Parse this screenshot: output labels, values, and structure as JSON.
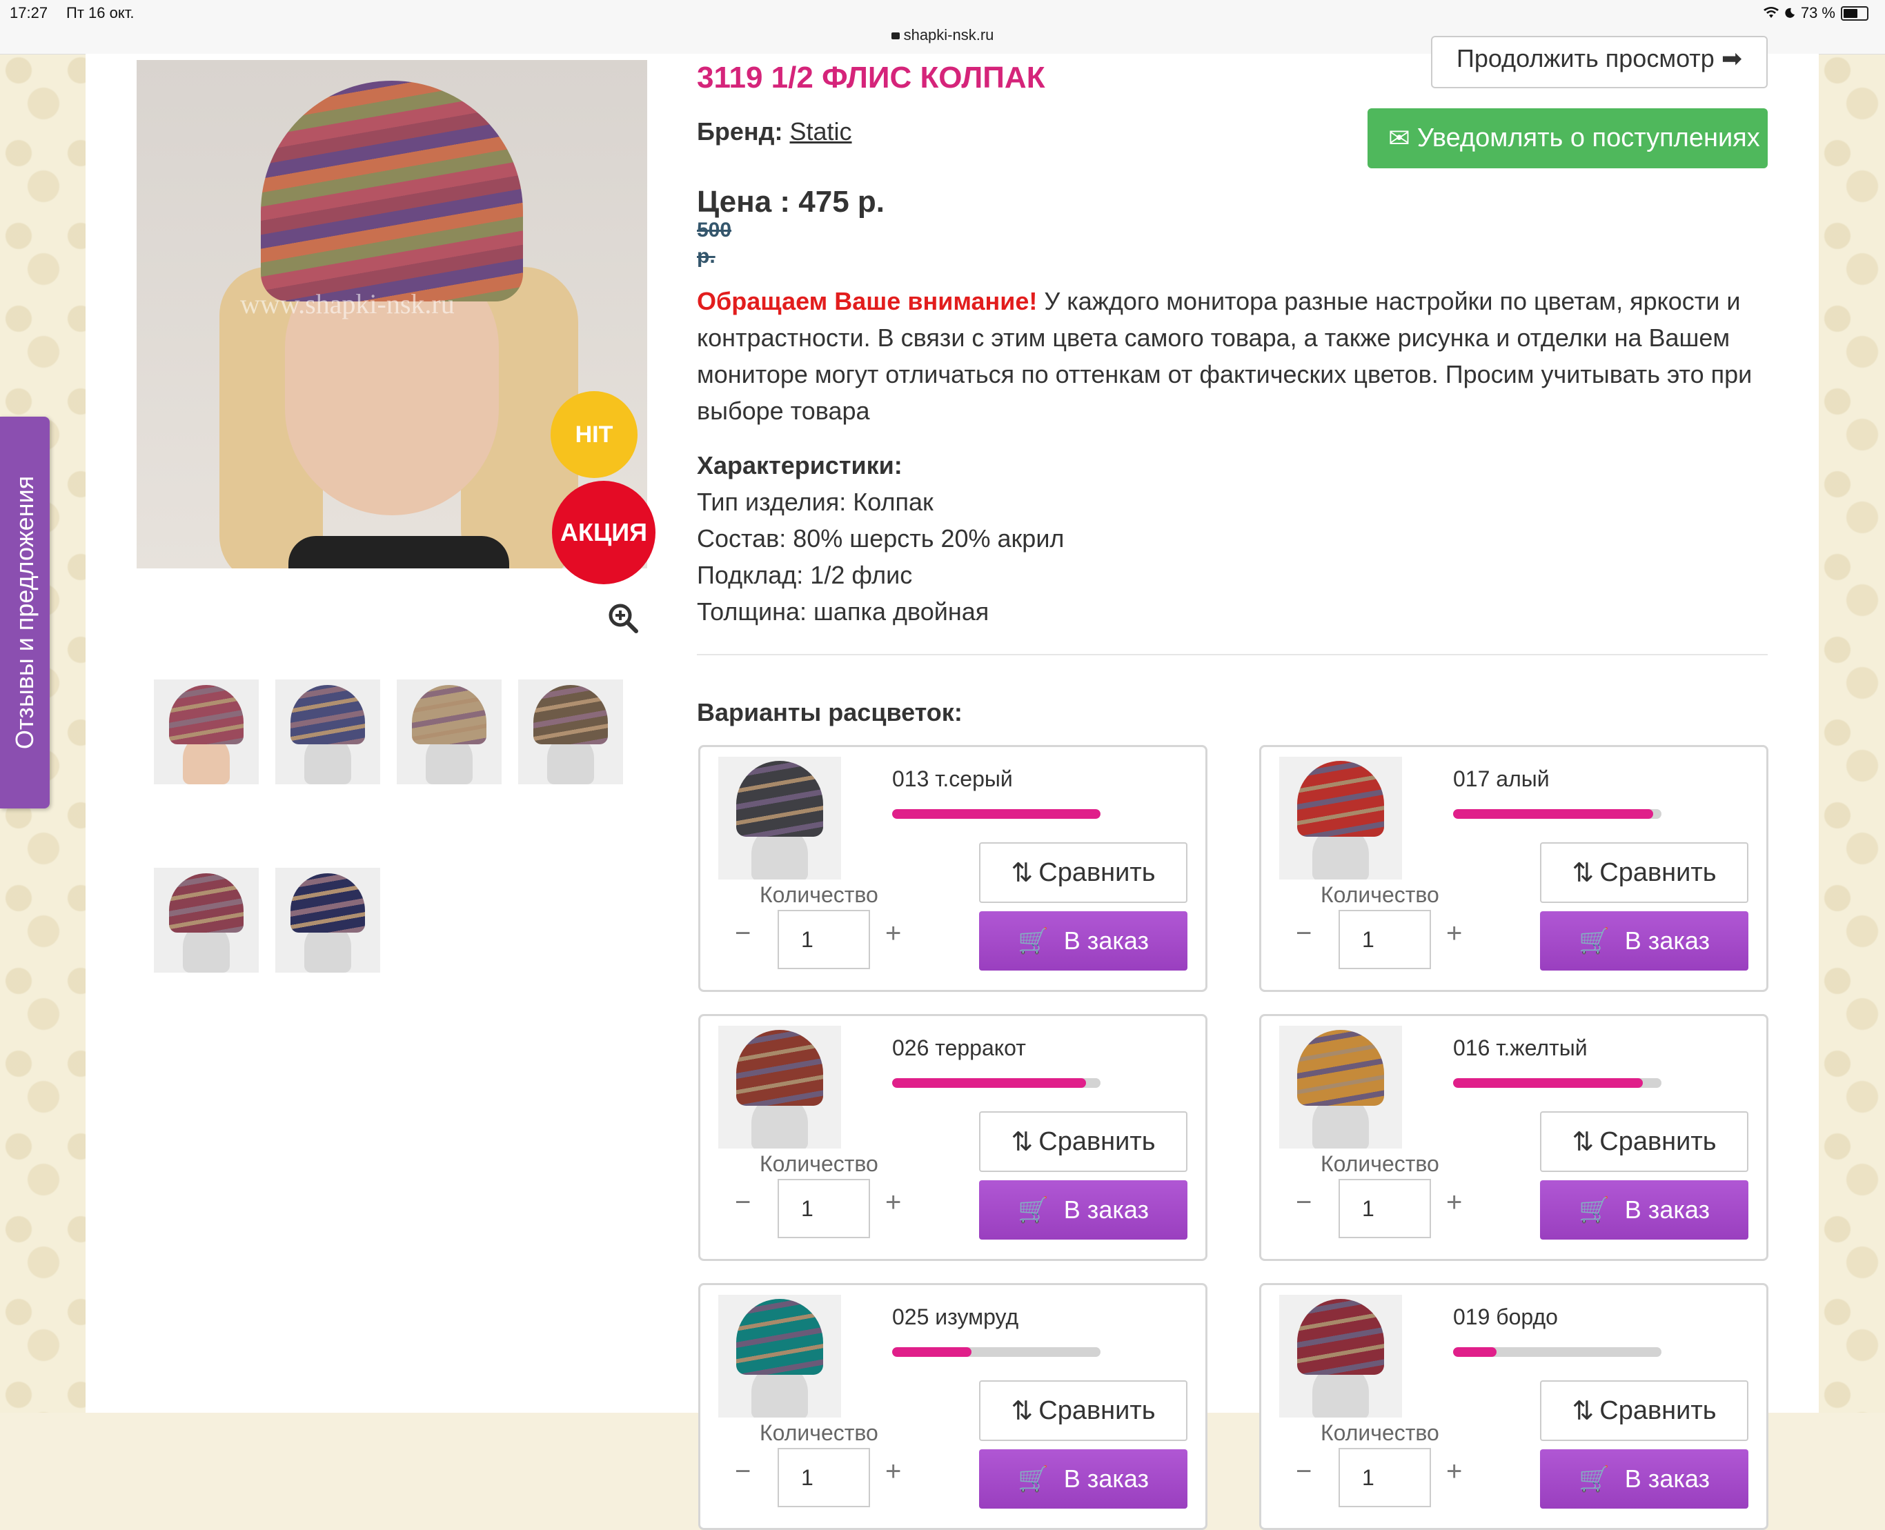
{
  "status_bar": {
    "time": "17:27",
    "date": "Пт 16 окт.",
    "battery": "73 %",
    "battery_level": 0.73
  },
  "browser": {
    "url": "shapki-nsk.ru"
  },
  "side_tab": {
    "label": "Отзывы и предложения"
  },
  "product": {
    "title": "3119 1/2 ФЛИС КОЛПАК",
    "brand_label": "Бренд:",
    "brand_value": "Static",
    "price": "Цена : 475 р.",
    "old_price": "500 р.",
    "watermark": "www.shapki-nsk.ru",
    "badges": {
      "hit": "HIT",
      "sale": "АКЦИЯ"
    }
  },
  "buttons": {
    "continue": "Продолжить просмотр",
    "notify": "Уведомлять о поступлениях"
  },
  "notice": {
    "warning": "Обращаем Ваше внимание!",
    "text": " У каждого монитора разные настройки по цветам, яркости и контрастности. В связи с этим цвета самого товара, а также рисунка и отделки на Вашем мониторе могут отличаться по оттенкам от фактических цветов. Просим учитывать это при выборе товара"
  },
  "specs": {
    "heading": "Характеристики:",
    "items": [
      "Тип изделия: Колпак",
      "Состав: 80% шерсть 20% акрил",
      "Подклад: 1/2 флис",
      "Толщина: шапка двойная"
    ]
  },
  "variants": {
    "title": "Варианты расцветок:",
    "compare_label": "Сравнить",
    "order_label": "В заказ",
    "qty_label": "Количество",
    "minus": "−",
    "plus": "+",
    "items": [
      {
        "name": "013 т.серый",
        "stock": 1.0,
        "qty": "1",
        "color": "#3f3f44"
      },
      {
        "name": "017 алый",
        "stock": 0.96,
        "qty": "1",
        "color": "#b8302b"
      },
      {
        "name": "026 терракот",
        "stock": 0.93,
        "qty": "1",
        "color": "#8a3a2e"
      },
      {
        "name": "016 т.желтый",
        "stock": 0.91,
        "qty": "1",
        "color": "#c58a3a"
      },
      {
        "name": "025 изумруд",
        "stock": 0.38,
        "qty": "1",
        "color": "#127e7b"
      },
      {
        "name": "019 бордо",
        "stock": 0.21,
        "qty": "1",
        "color": "#8a2d3a"
      }
    ]
  },
  "thumbnails": [
    "#9b4a5c",
    "#4a4d7a",
    "#b39a7a",
    "#6e5b48",
    "#8a4050",
    "#2c2f5a"
  ]
}
